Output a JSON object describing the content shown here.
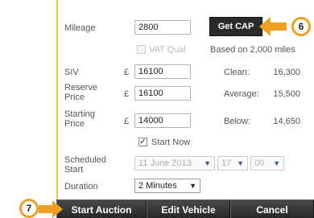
{
  "form": {
    "mileage_label": "Mileage",
    "mileage_value": "2800",
    "get_cap_label": "Get CAP",
    "vat_qual_label": "VAT Qual",
    "based_on_text": "Based on 2,000 miles",
    "siv_label": "SIV",
    "reserve_label": "Reserve Price",
    "starting_label": "Starting Price",
    "currency_symbol": "£",
    "siv_value": "16100",
    "reserve_value": "16100",
    "starting_value": "14000",
    "clean_label": "Clean:",
    "clean_value": "16,300",
    "average_label": "Average:",
    "average_value": "15,500",
    "below_label": "Below:",
    "below_value": "14,650",
    "start_now_label": "Start Now",
    "start_now_checked": true,
    "vat_qual_checked": false,
    "scheduled_label": "Scheduled Start",
    "scheduled_date": "11 June 2013",
    "scheduled_hour": "17",
    "scheduled_minute": "00",
    "duration_label": "Duration",
    "duration_value": "2 Minutes"
  },
  "actions": {
    "start_auction_label": "Start Auction",
    "edit_vehicle_label": "Edit Vehicle",
    "cancel_label": "Cancel"
  },
  "callouts": {
    "six": "6",
    "seven": "7"
  },
  "colors": {
    "callout": "#f0a020",
    "button_dark": "#2a2a2a",
    "link_chevron": "#3a5fa0"
  }
}
